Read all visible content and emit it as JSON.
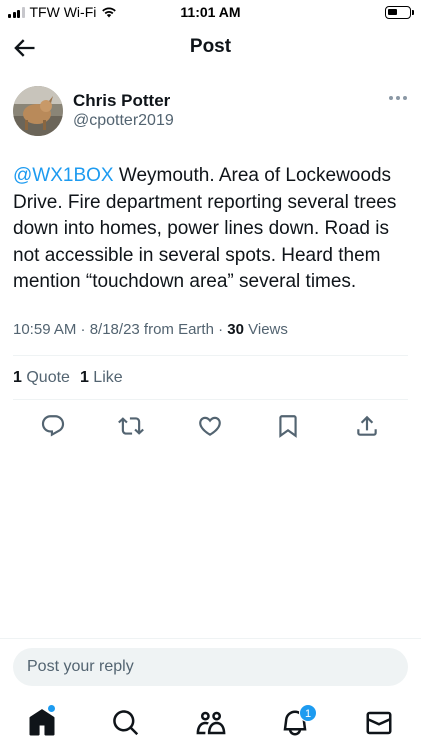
{
  "status_bar": {
    "carrier": "TFW Wi-Fi",
    "time": "11:01 AM",
    "battery_level": 0.4
  },
  "header": {
    "title": "Post",
    "back_icon": "arrow-left-icon"
  },
  "author": {
    "name": "Chris Potter",
    "handle": "@cpotter2019"
  },
  "tweet": {
    "mention": "@WX1BOX",
    "text": " Weymouth. Area of Lockewoods Drive. Fire department reporting several trees down into homes, power lines down. Road is not accessible in several spots. Heard them mention “touchdown area” several times."
  },
  "meta": {
    "timestamp": "10:59 AM · 8/18/23 from Earth · ",
    "views_count": "30",
    "views_label": " Views"
  },
  "stats": {
    "quotes_count": "1",
    "quotes_label": " Quote",
    "likes_count": "1",
    "likes_label": " Like"
  },
  "actions": [
    "reply-icon",
    "retweet-icon",
    "like-icon",
    "bookmark-icon",
    "share-icon"
  ],
  "reply": {
    "placeholder": "Post your reply"
  },
  "tabbar": {
    "items": [
      "home-icon",
      "search-icon",
      "communities-icon",
      "notifications-icon",
      "messages-icon"
    ],
    "notifications_badge": "1"
  },
  "colors": {
    "accent": "#1d9bf0",
    "text_primary": "#0f1419",
    "text_secondary": "#536471",
    "divider": "#eff3f4"
  }
}
